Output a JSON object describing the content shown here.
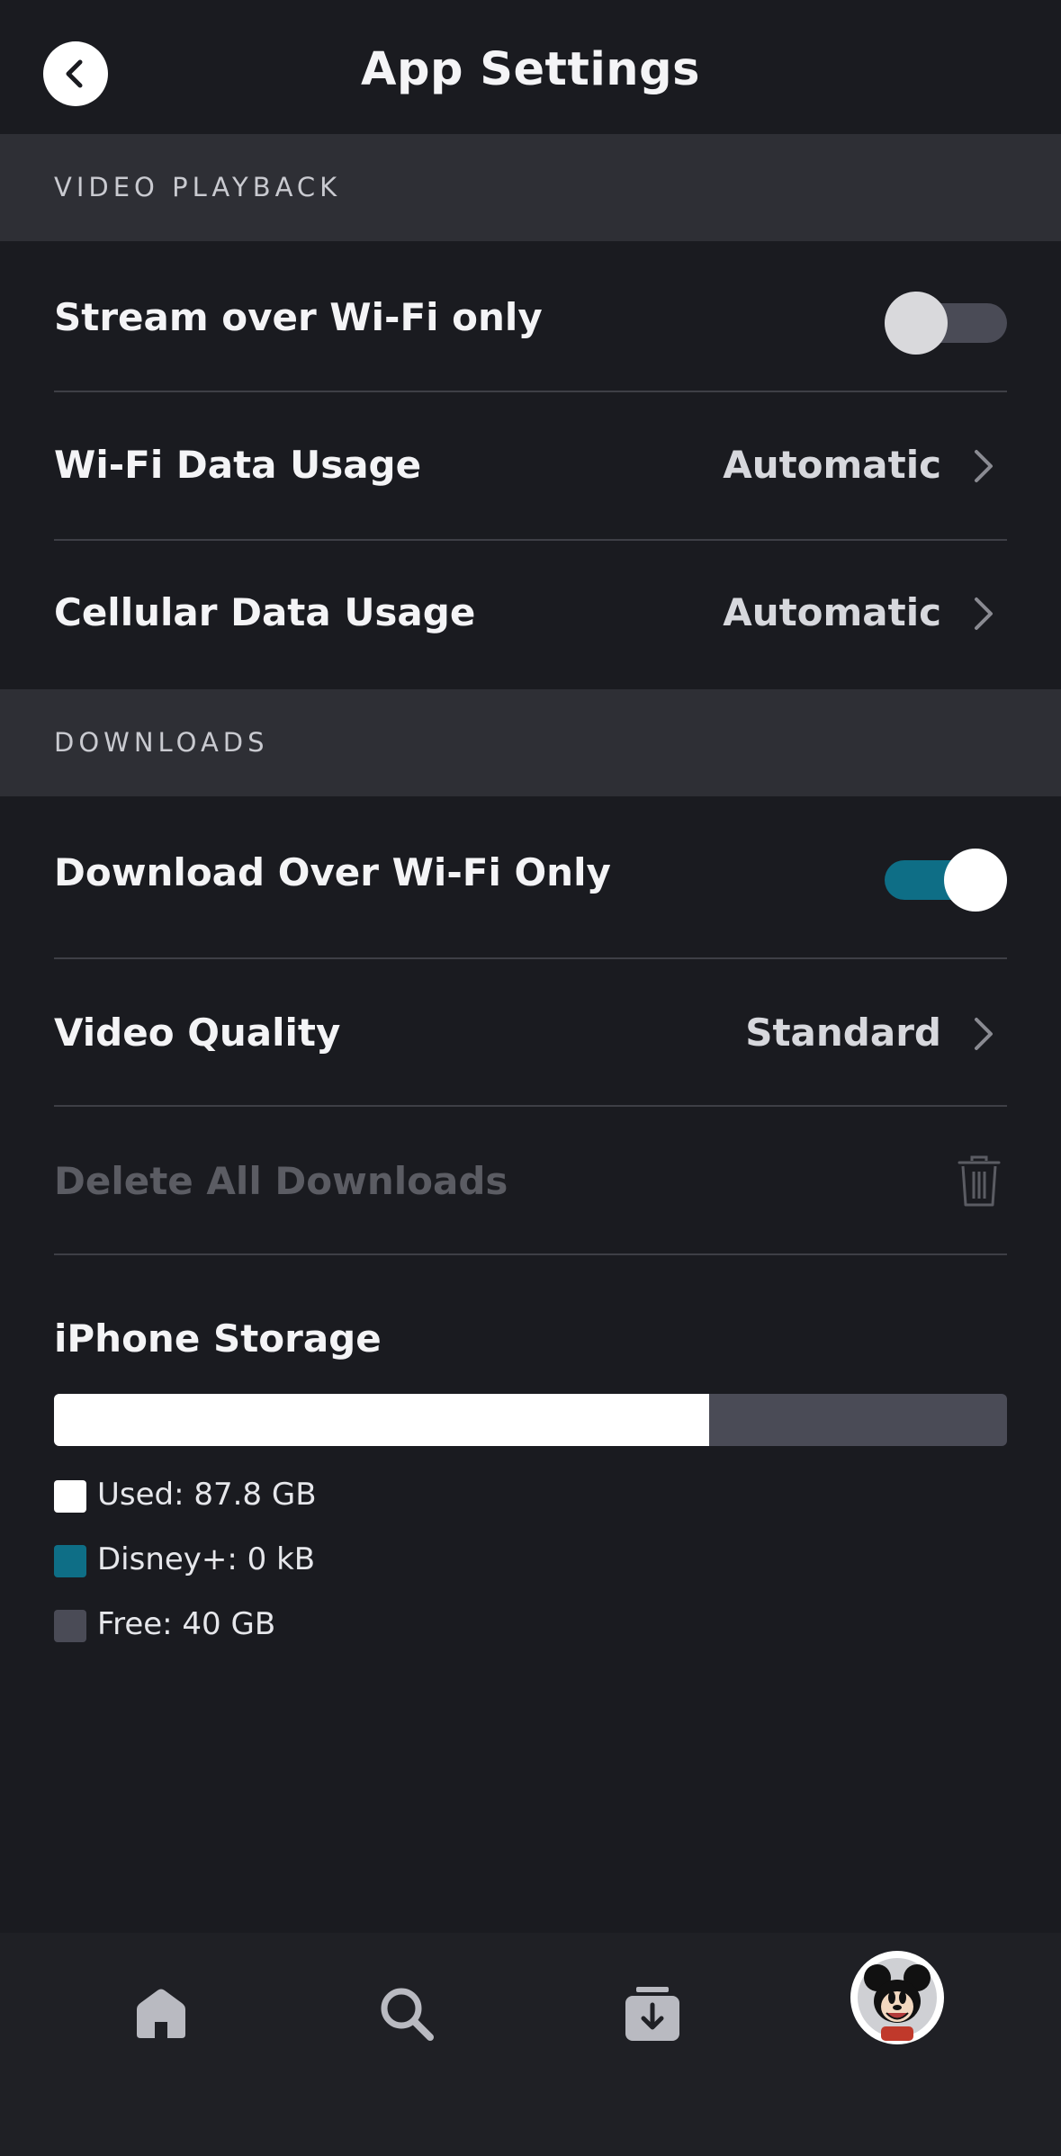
{
  "header": {
    "title": "App Settings"
  },
  "sections": {
    "video_playback": "VIDEO PLAYBACK",
    "downloads": "DOWNLOADS"
  },
  "video_playback": {
    "stream_wifi_only": {
      "label": "Stream over Wi-Fi only",
      "enabled": false
    },
    "wifi_data_usage": {
      "label": "Wi-Fi Data Usage",
      "value": "Automatic"
    },
    "cellular_data_usage": {
      "label": "Cellular Data Usage",
      "value": "Automatic"
    }
  },
  "downloads": {
    "download_wifi_only": {
      "label": "Download Over Wi-Fi Only",
      "enabled": true
    },
    "video_quality": {
      "label": "Video Quality",
      "value": "Standard"
    },
    "delete_all": {
      "label": "Delete All Downloads"
    }
  },
  "storage": {
    "title": "iPhone Storage",
    "used_fraction": 0.687,
    "legend": [
      {
        "label": "Used: 87.8 GB",
        "color": "#ffffff"
      },
      {
        "label": "Disney+: 0 kB",
        "color": "#0e6e86"
      },
      {
        "label": "Free: 40 GB",
        "color": "#4a4b56"
      }
    ]
  },
  "nav": {
    "items": [
      "home-icon",
      "search-icon",
      "downloads-icon",
      "profile-avatar"
    ]
  },
  "colors": {
    "background": "#1a1b20",
    "section": "#2e2f35",
    "accent": "#0e6e86",
    "disabled_text": "#5b5c63"
  }
}
